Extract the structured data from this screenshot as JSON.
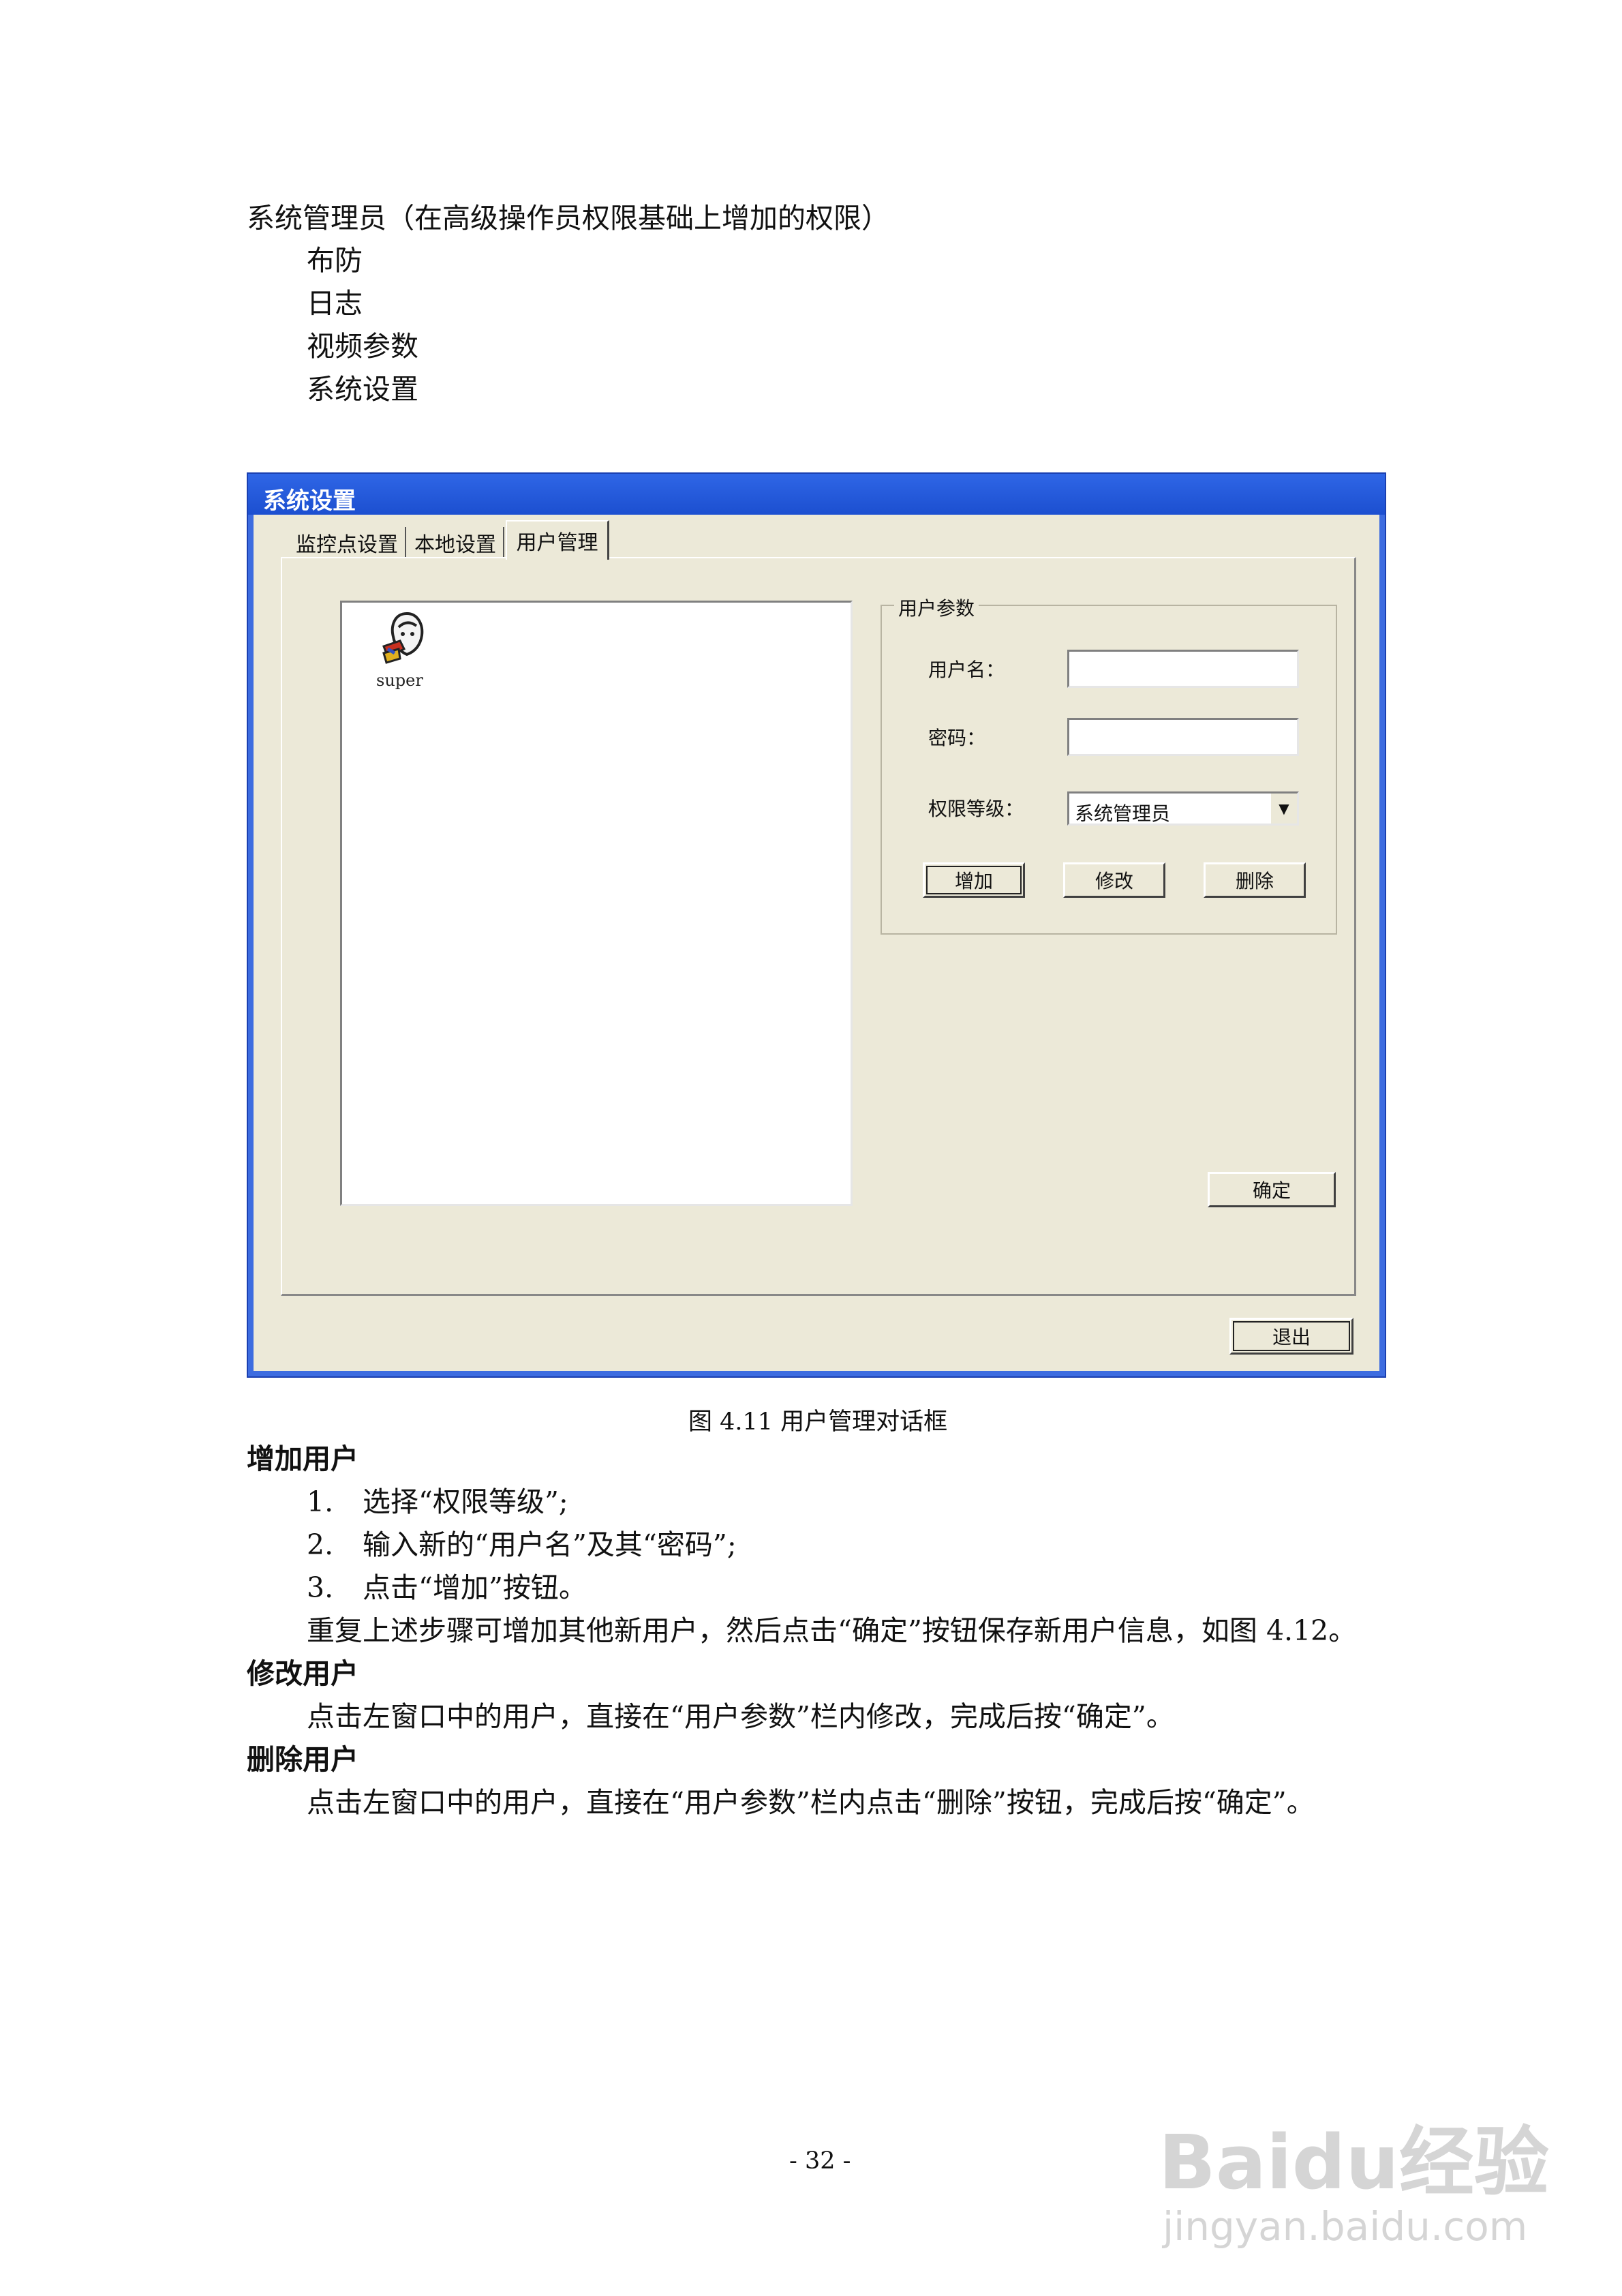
{
  "intro": {
    "heading": "系统管理员（在高级操作员权限基础上增加的权限）",
    "items": [
      "布防",
      "日志",
      "视频参数",
      "系统设置"
    ]
  },
  "dialog": {
    "title": "系统设置",
    "tabs": [
      "监控点设置",
      "本地设置",
      "用户管理"
    ],
    "active_tab": "用户管理",
    "user_list": [
      "super"
    ],
    "group_label": "用户参数",
    "username_label": "用户名：",
    "username_value": "",
    "password_label": "密码：",
    "password_value": "",
    "permission_label": "权限等级：",
    "permission_value": "系统管理员",
    "add_button": "增加",
    "modify_button": "修改",
    "delete_button": "删除",
    "ok_button": "确定",
    "exit_button": "退出",
    "colors": {
      "titlebar": "#1c4fd0",
      "face": "#ece9d8"
    }
  },
  "caption": "图 4.11  用户管理对话框",
  "add_user": {
    "heading": "增加用户",
    "steps": [
      {
        "num": "1.",
        "text": "选择“权限等级”;"
      },
      {
        "num": "2.",
        "text": "输入新的“用户名”及其“密码”;"
      },
      {
        "num": "3.",
        "text": "点击“增加”按钮。"
      }
    ],
    "note": "重复上述步骤可增加其他新用户，然后点击“确定”按钮保存新用户信息，如图 4.12。"
  },
  "modify_user": {
    "heading": "修改用户",
    "text": "点击左窗口中的用户，直接在“用户参数”栏内修改，完成后按“确定”。"
  },
  "delete_user": {
    "heading": "删除用户",
    "text": "点击左窗口中的用户，直接在“用户参数”栏内点击“删除”按钮，完成后按“确定”。"
  },
  "page_number": "- 32 -",
  "watermark": {
    "brand": "Baidu经验",
    "url": "jingyan.baidu.com"
  }
}
